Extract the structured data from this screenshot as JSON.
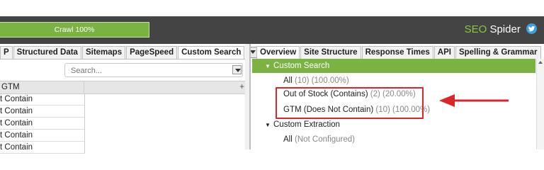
{
  "header": {
    "progress_label": "Crawl 100%",
    "progress": 1.0,
    "brand_prefix": "SEO",
    "brand_suffix": " Spider",
    "brand_icon": "twitter-icon"
  },
  "left_tabs": [
    {
      "label": "P"
    },
    {
      "label": "Structured Data"
    },
    {
      "label": "Sitemaps"
    },
    {
      "label": "PageSpeed"
    },
    {
      "label": "Custom Search",
      "active": true
    }
  ],
  "left_panel": {
    "search_placeholder": "Search...",
    "column_header": "GTM",
    "add_column": "+",
    "rows": [
      "t Contain",
      "t Contain",
      "t Contain",
      "t Contain",
      "t Contain"
    ]
  },
  "right_tabs": [
    {
      "label": "Overview",
      "active": true
    },
    {
      "label": "Site Structure"
    },
    {
      "label": "Response Times"
    },
    {
      "label": "API"
    },
    {
      "label": "Spelling & Grammar"
    }
  ],
  "tree": {
    "custom_search": "Custom Search",
    "all_label": "All",
    "all_stats": "(10) (100.00%)",
    "out_of_stock_label": "Out of Stock (Contains)",
    "out_of_stock_stats": "(2) (20.00%)",
    "gtm_label": "GTM (Does Not Contain)",
    "gtm_stats": "(10) (100.00%)",
    "custom_extraction": "Custom Extraction",
    "extraction_all_label": "All",
    "extraction_all_stats": "(Not Configured)"
  },
  "colors": {
    "accent_green": "#7ab342",
    "highlight_red": "#d9262b",
    "topbar": "#444444"
  }
}
